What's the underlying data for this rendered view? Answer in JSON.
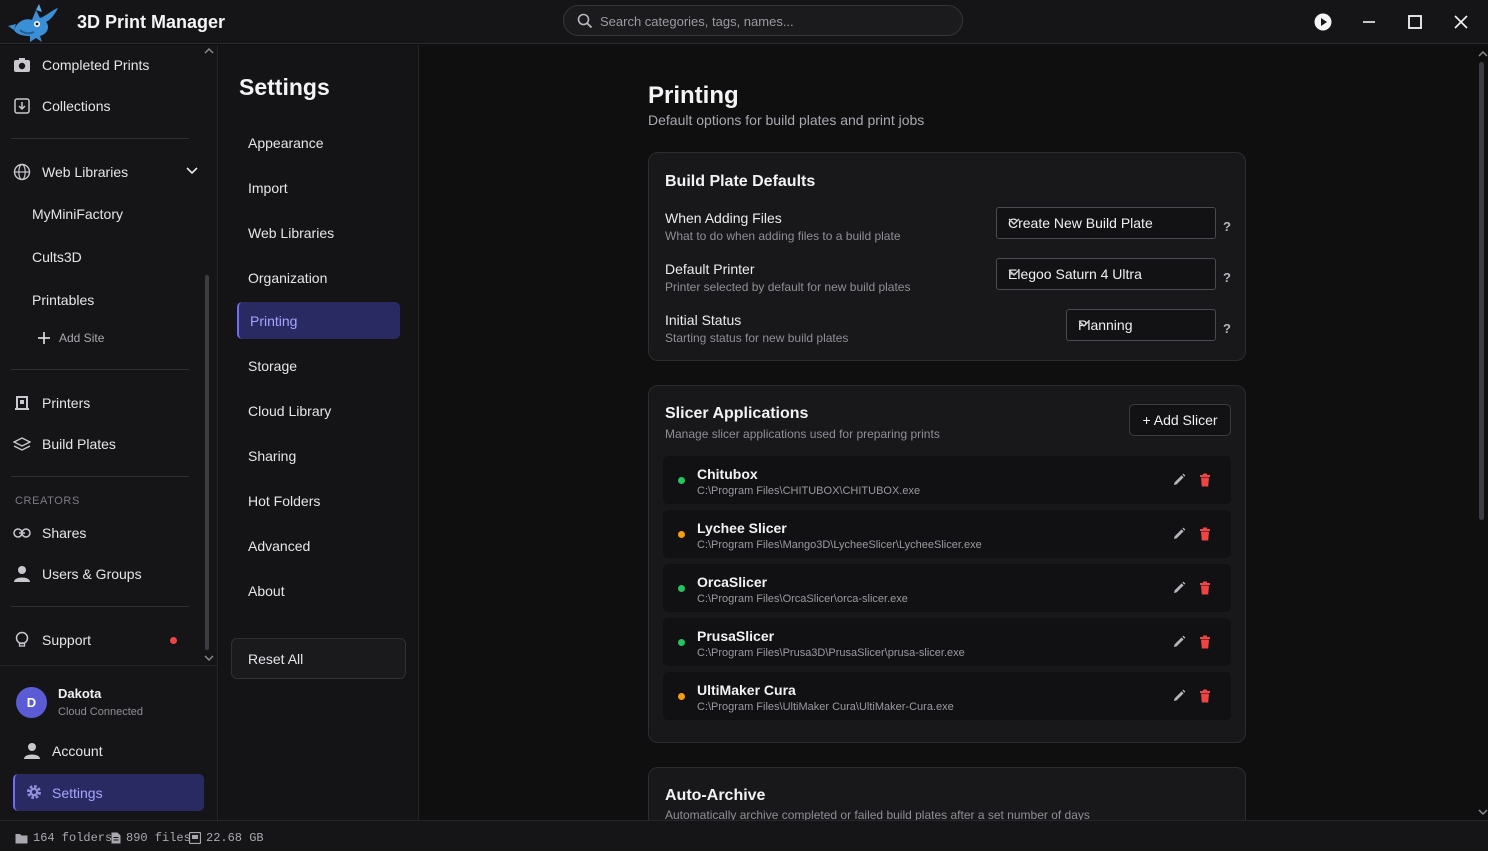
{
  "app": {
    "title": "3D Print Manager"
  },
  "search": {
    "placeholder": "Search categories, tags, names..."
  },
  "sidebar": {
    "top_items": [
      {
        "label": "Completed Prints",
        "icon": "camera-icon"
      },
      {
        "label": "Collections",
        "icon": "download-box-icon"
      }
    ],
    "web_libraries": {
      "label": "Web Libraries",
      "icon": "globe-icon",
      "sites": [
        "MyMiniFactory",
        "Cults3D",
        "Printables"
      ],
      "add_site_label": "Add Site"
    },
    "hardware_items": [
      {
        "label": "Printers",
        "icon": "printer-icon"
      },
      {
        "label": "Build Plates",
        "icon": "layers-icon"
      }
    ],
    "creators": {
      "section_label": "CREATORS",
      "items": [
        {
          "label": "Shares",
          "icon": "link-icon"
        },
        {
          "label": "Users & Groups",
          "icon": "user-icon"
        }
      ]
    },
    "support": {
      "label": "Support"
    },
    "user": {
      "initial": "D",
      "name": "Dakota",
      "status": "Cloud Connected"
    },
    "account_label": "Account",
    "settings_label": "Settings"
  },
  "settings_nav": {
    "title": "Settings",
    "items": [
      "Appearance",
      "Import",
      "Web Libraries",
      "Organization",
      "Printing",
      "Storage",
      "Cloud Library",
      "Sharing",
      "Hot Folders",
      "Advanced",
      "About"
    ],
    "active": "Printing",
    "reset_label": "Reset All"
  },
  "page": {
    "title": "Printing",
    "subtitle": "Default options for build plates and print jobs"
  },
  "build_plate_defaults": {
    "title": "Build Plate Defaults",
    "rows": [
      {
        "label": "When Adding Files",
        "description": "What to do when adding files to a build plate",
        "value": "Create New Build Plate"
      },
      {
        "label": "Default Printer",
        "description": "Printer selected by default for new build plates",
        "value": "Elegoo Saturn 4 Ultra"
      },
      {
        "label": "Initial Status",
        "description": "Starting status for new build plates",
        "value": "Planning"
      }
    ],
    "help_label": "?"
  },
  "slicers": {
    "title": "Slicer Applications",
    "subtitle": "Manage slicer applications used for preparing prints",
    "add_label": "+ Add Slicer",
    "items": [
      {
        "name": "Chitubox",
        "path": "C:\\Program Files\\CHITUBOX\\CHITUBOX.exe",
        "status_color": "#22c55e"
      },
      {
        "name": "Lychee Slicer",
        "path": "C:\\Program Files\\Mango3D\\LycheeSlicer\\LycheeSlicer.exe",
        "status_color": "#f59e0b"
      },
      {
        "name": "OrcaSlicer",
        "path": "C:\\Program Files\\OrcaSlicer\\orca-slicer.exe",
        "status_color": "#22c55e"
      },
      {
        "name": "PrusaSlicer",
        "path": "C:\\Program Files\\Prusa3D\\PrusaSlicer\\prusa-slicer.exe",
        "status_color": "#22c55e"
      },
      {
        "name": "UltiMaker Cura",
        "path": "C:\\Program Files\\UltiMaker Cura\\UltiMaker-Cura.exe",
        "status_color": "#f59e0b"
      }
    ]
  },
  "auto_archive": {
    "title": "Auto-Archive",
    "subtitle": "Automatically archive completed or failed build plates after a set number of days"
  },
  "statusbar": {
    "folders": "164 folders",
    "files": "890 files",
    "size": "22.68 GB"
  },
  "colors": {
    "accent": "#6d6df5",
    "accent_bg": "#2a2a63",
    "delete": "#ef4444"
  }
}
